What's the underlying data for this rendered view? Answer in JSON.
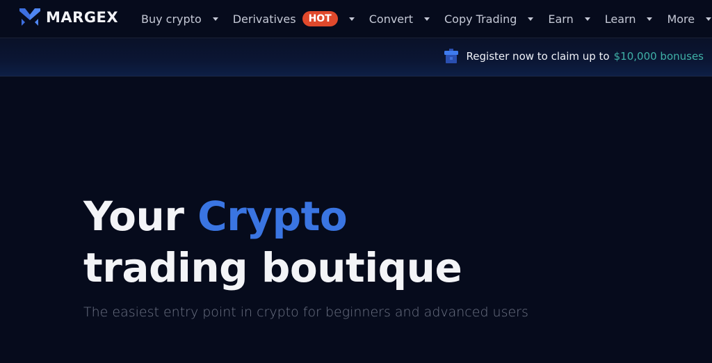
{
  "brand": {
    "name": "MARGEX",
    "logo_icon": "margex-m-logo-icon"
  },
  "nav": {
    "items": [
      {
        "label": "Buy crypto",
        "has_dropdown": true
      },
      {
        "label": "Derivatives",
        "badge": "HOT",
        "has_dropdown": true
      },
      {
        "label": "Convert",
        "has_dropdown": true
      },
      {
        "label": "Copy Trading",
        "has_dropdown": true
      },
      {
        "label": "Earn",
        "has_dropdown": true
      },
      {
        "label": "Learn",
        "has_dropdown": true
      },
      {
        "label": "More",
        "has_dropdown": true
      }
    ]
  },
  "promo": {
    "icon": "gift-icon",
    "text": "Register now to claim up to",
    "amount": "$10,000 bonuses"
  },
  "hero": {
    "title_part1": "Your",
    "title_accent": "Crypto",
    "title_line2": "trading boutique",
    "subtitle": "The easiest entry point in crypto for beginners and advanced users"
  },
  "colors": {
    "background": "#060b1c",
    "accent_blue": "#3a75e2",
    "hot_badge": "#e0492c",
    "promo_amount": "#3fb1a7"
  }
}
